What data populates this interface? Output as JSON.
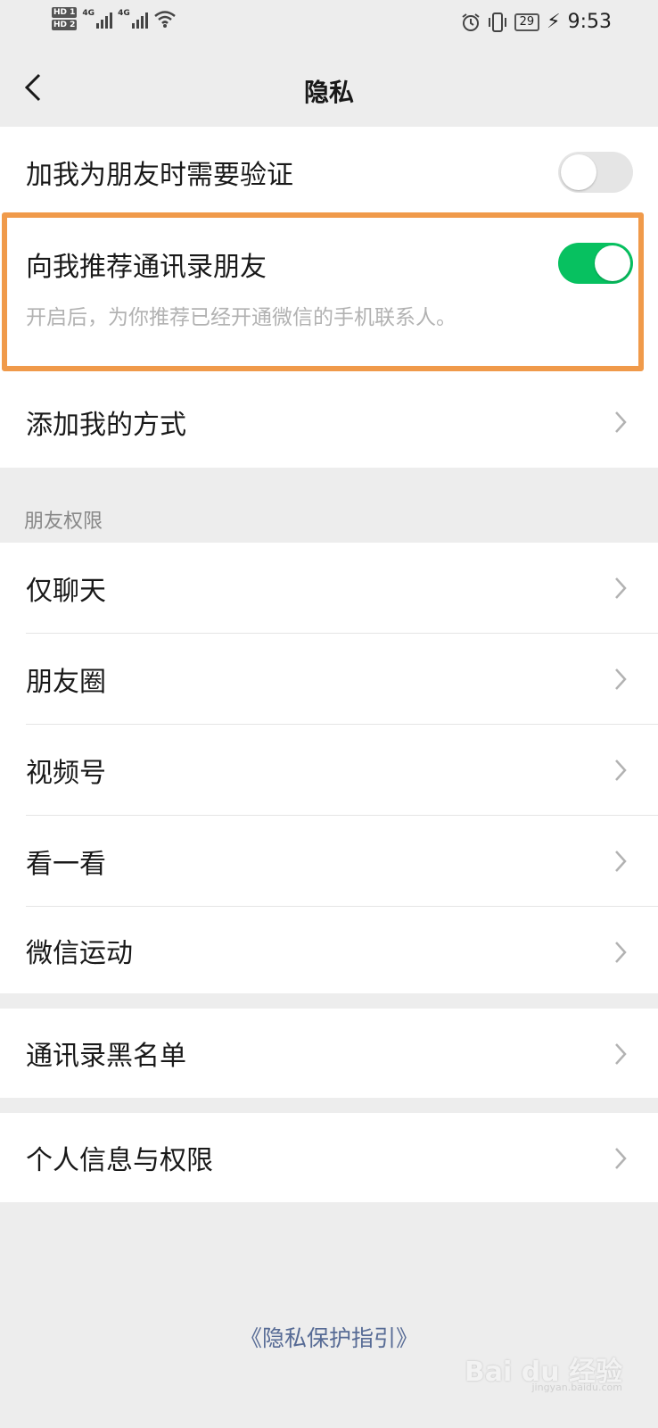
{
  "status_bar": {
    "hd1": "HD 1",
    "hd2": "HD 2",
    "net1": "4G",
    "net2": "4G",
    "battery": "29",
    "time": "9:53"
  },
  "header": {
    "title": "隐私"
  },
  "group1": {
    "verify_label": "加我为朋友时需要验证",
    "verify_toggle": "off",
    "recommend_label": "向我推荐通讯录朋友",
    "recommend_toggle": "on",
    "recommend_desc": "开启后，为你推荐已经开通微信的手机联系人。",
    "add_methods_label": "添加我的方式"
  },
  "friend_permissions": {
    "section_title": "朋友权限",
    "items": [
      "仅聊天",
      "朋友圈",
      "视频号",
      "看一看",
      "微信运动"
    ]
  },
  "blacklist_label": "通讯录黑名单",
  "personal_info_label": "个人信息与权限",
  "footer": {
    "privacy_guide": "《隐私保护指引》"
  },
  "watermark": {
    "text": "Bai du 经验",
    "url": "jingyan.baidu.com"
  },
  "colors": {
    "accent_green": "#07c160",
    "highlight_orange": "#f09a4a",
    "link_blue": "#576b95"
  }
}
